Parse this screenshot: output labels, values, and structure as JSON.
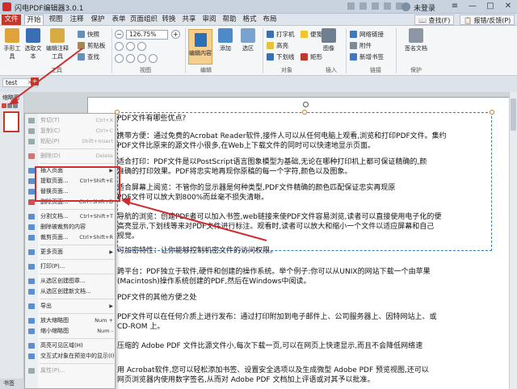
{
  "app": {
    "title": "闪电PDF编辑器3.0.1",
    "login": "未登录"
  },
  "window_controls": {
    "menu": "≡",
    "minimize": "—",
    "maximize": "□",
    "close": "✕"
  },
  "menu_tabs": [
    {
      "label": "文件"
    },
    {
      "label": "开始"
    },
    {
      "label": "视图"
    },
    {
      "label": "注释"
    },
    {
      "label": "保护"
    },
    {
      "label": "表单"
    },
    {
      "label": "页面组织"
    },
    {
      "label": "转换"
    },
    {
      "label": "共享"
    },
    {
      "label": "审阅"
    },
    {
      "label": "帮助"
    },
    {
      "label": "格式"
    },
    {
      "label": "布局"
    }
  ],
  "header_buttons": {
    "user_manual": "📖 查找(F)",
    "feedback": "📋 报错/反馈(P)"
  },
  "ribbon": {
    "tools": {
      "hand_tool": "手形工具",
      "select_text": "选取文本",
      "edit_annot": "编辑注释工具",
      "snapshot": "快照",
      "clipboard": "剪贴板",
      "find": "查找",
      "group": "工具"
    },
    "view": {
      "zoom_value": "126.75%",
      "group": "视图"
    },
    "edit": {
      "edit_content": "编辑内容",
      "add": "添加",
      "group": "编辑"
    },
    "object": {
      "typewriter": "打字机",
      "highlight": "高亮",
      "underline": "下划线",
      "group": "对象"
    },
    "insert": {
      "sticky": "便笺",
      "rect": "矩形",
      "image": "图像",
      "group": "插入"
    },
    "links": {
      "link": "网络链接",
      "file_attach": "附件",
      "add_bookmark": "新增书签",
      "group": "链接"
    },
    "protect": {
      "sign": "签名文档",
      "group": "保护"
    },
    "select_label": "选区"
  },
  "doc_tab": {
    "name": "test",
    "close": "×",
    "add": "+"
  },
  "left_panel": {
    "title": "缩略图",
    "bookmark": "书签"
  },
  "document": {
    "lines": [
      "PDF文件有哪些优点?",
      "携带方便：通过免费的Acrobat Reader软件,接件人可以从任何电脑上观看,浏览和打印PDF文件。集约",
      "PDF文件比原来的源文件小很多,在Web上下载文件的同时可以快速地显示页面。",
      "适合打印：PDF文件是以PostScript语言图象模型为基础,无论在哪种打印机上都可保证精确的,颜",
      "准确的打印效果。PDF将忠实地再现你原稿的每一个字符,颜色以及图象。",
      "适合屏幕上阅览：不管你的显示器是何种类型,PDF文件精确的颜色匹配保证忠实再现原",
      "PDF文件可以放大到800%而丝毫不损失清晰。",
      "导航的浏览：创建PDF者可以加入书签,web链接来使PDF文件容易浏览,读者可以直接使用电子化的便",
      "高亮显示,下划线等来对PDF文件进行标注。观看时,读者可以放大和缩小一个文件以适应屏幕和自己",
      "视觉。",
      "可加密特性：让你能够控制机密文件的访问权限。",
      "跨平台：PDF独立于软件,硬件和创建的操作系统。举个例子:你可以从UNIX的网站下载一个由苹果",
      "(Macintosh)操作系统创建的PDF,然后在Windows中阅读。",
      "PDF文件的其他方便之处",
      "PDF文件可以在任何介质上进行发布：通过打印附加到电子邮件上、公司服务器上、因特网站上、或",
      "CD-ROM 上。",
      "压缩的 Adobe PDF 文件比源文件小,每次下载一页,可以在网页上快速显示,而且不会降低网络速",
      "用 Acrobat软件,您可以轻松添加书签、设置安全选项以及生成微型 Adobe PDF 预览视图,还可以",
      "网页浏览器内使用数字签名,从而对 Adobe PDF 文档加上评语或对其予以批准。"
    ]
  },
  "context_menu": {
    "items": [
      {
        "label": "剪切(T)",
        "shortcut": "Ctrl+X",
        "disabled": true,
        "icon_color": "#9aa"
      },
      {
        "label": "复制(C)",
        "shortcut": "Ctrl+C",
        "disabled": true,
        "icon_color": "#9aa"
      },
      {
        "label": "粘贴(P)",
        "shortcut": "Shift+Insert",
        "disabled": true,
        "icon_color": "#9aa"
      },
      {
        "sep": true
      },
      {
        "label": "删除(D)",
        "shortcut": "Delete",
        "disabled": true,
        "icon_color": "#c77"
      },
      {
        "sep": true
      },
      {
        "label": "插入页面",
        "arrow": "▶",
        "icon_color": "#5b8fd1"
      },
      {
        "label": "提取页面...",
        "shortcut": "Ctrl+Shift+E",
        "icon_color": "#5b8fd1"
      },
      {
        "label": "替换页面...",
        "icon_color": "#5b8fd1"
      },
      {
        "label": "删除页面...",
        "shortcut": "Ctrl+Shift+D",
        "icon_color": "#d05050"
      },
      {
        "sep": true
      },
      {
        "label": "分割文档...",
        "shortcut": "Ctrl+Shift+T",
        "icon_color": "#5b8fd1"
      },
      {
        "label": "删除被裁剪的内容",
        "icon_color": "#5b8fd1"
      },
      {
        "label": "裁剪页面...",
        "shortcut": "Ctrl+Shift+R",
        "icon_color": "#5b8fd1"
      },
      {
        "sep": true
      },
      {
        "label": "更多页面",
        "arrow": "▶",
        "icon_color": "#5b8fd1"
      },
      {
        "sep": true
      },
      {
        "label": "打印(P)...",
        "icon_color": "#5b8fd1"
      },
      {
        "sep": true
      },
      {
        "label": "从选区创建图章...",
        "icon_color": "#5b8fd1"
      },
      {
        "label": "从选区创建新文档...",
        "icon_color": "#5b8fd1"
      },
      {
        "sep": true
      },
      {
        "label": "导出",
        "arrow": "▶",
        "icon_color": "#5b8fd1"
      },
      {
        "sep": true
      },
      {
        "label": "放大缩略图",
        "shortcut": "Num +",
        "icon_color": "#5b8fd1"
      },
      {
        "label": "缩小缩略图",
        "shortcut": "Num -",
        "icon_color": "#5b8fd1"
      },
      {
        "sep": true
      },
      {
        "label": "高亮可见区域(H)",
        "icon_color": "#5b8fd1"
      },
      {
        "label": "交互式对象在预览中的显示(I)",
        "icon_color": "#5b8fd1"
      },
      {
        "sep": true
      },
      {
        "label": "属性(P)...",
        "disabled": true,
        "icon_color": "#9aa"
      }
    ]
  },
  "colors": {
    "accent": "#c0392b",
    "annotation": "#d22b2b"
  }
}
